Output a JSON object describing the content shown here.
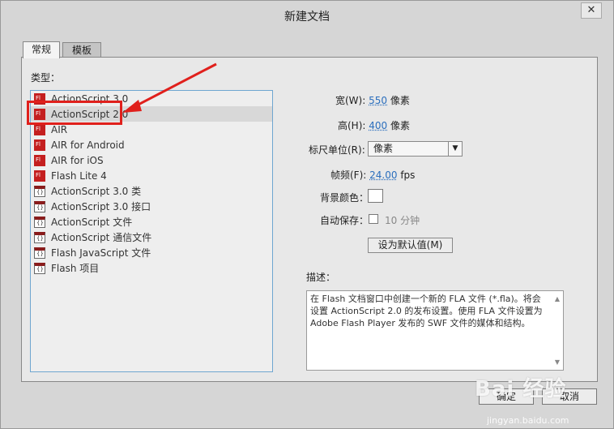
{
  "dialog": {
    "title": "新建文档",
    "close_glyph": "✕"
  },
  "tabs": [
    {
      "label": "常规",
      "active": true
    },
    {
      "label": "模板",
      "active": false
    }
  ],
  "type_section": {
    "label": "类型：",
    "items": [
      {
        "label": "ActionScript 3.0",
        "icon": "flash-fla-icon",
        "selected": false
      },
      {
        "label": "ActionScript 2.0",
        "icon": "flash-fla-icon",
        "selected": true
      },
      {
        "label": "AIR",
        "icon": "flash-fla-icon",
        "selected": false
      },
      {
        "label": "AIR for Android",
        "icon": "flash-fla-icon",
        "selected": false
      },
      {
        "label": "AIR for iOS",
        "icon": "flash-fla-icon",
        "selected": false
      },
      {
        "label": "Flash Lite 4",
        "icon": "flash-fla-icon",
        "selected": false
      },
      {
        "label": "ActionScript 3.0 类",
        "icon": "actionscript-file-icon",
        "selected": false
      },
      {
        "label": "ActionScript 3.0 接口",
        "icon": "actionscript-file-icon",
        "selected": false
      },
      {
        "label": "ActionScript 文件",
        "icon": "actionscript-file-icon",
        "selected": false
      },
      {
        "label": "ActionScript 通信文件",
        "icon": "actionscript-file-icon",
        "selected": false
      },
      {
        "label": "Flash JavaScript 文件",
        "icon": "jsfl-file-icon",
        "selected": false
      },
      {
        "label": "Flash 项目",
        "icon": "flash-project-icon",
        "selected": false
      }
    ]
  },
  "settings": {
    "width_label": "宽(W):",
    "width_value": "550",
    "width_unit": "像素",
    "height_label": "高(H):",
    "height_value": "400",
    "height_unit": "像素",
    "ruler_label": "标尺单位(R):",
    "ruler_value": "像素",
    "fps_label": "帧频(F):",
    "fps_value": "24.00",
    "fps_unit": "fps",
    "bg_label": "背景颜色：",
    "bg_color": "#ffffff",
    "autosave_label": "自动保存：",
    "autosave_checked": false,
    "autosave_value": "10",
    "autosave_unit": "分钟",
    "default_button": "设为默认值(M)"
  },
  "description": {
    "label": "描述：",
    "text": "在 Flash 文档窗口中创建一个新的 FLA 文件 (*.fla)。将会设置 ActionScript 2.0 的发布设置。使用 FLA 文件设置为 Adobe Flash Player 发布的 SWF 文件的媒体和结构。"
  },
  "buttons": {
    "ok": "确定",
    "cancel": "取消"
  },
  "watermark": {
    "brand": "Bai 经验",
    "url": "jingyan.baidu.com"
  },
  "colors": {
    "annotation_red": "#e0201c",
    "link_blue": "#2a6ebd"
  }
}
